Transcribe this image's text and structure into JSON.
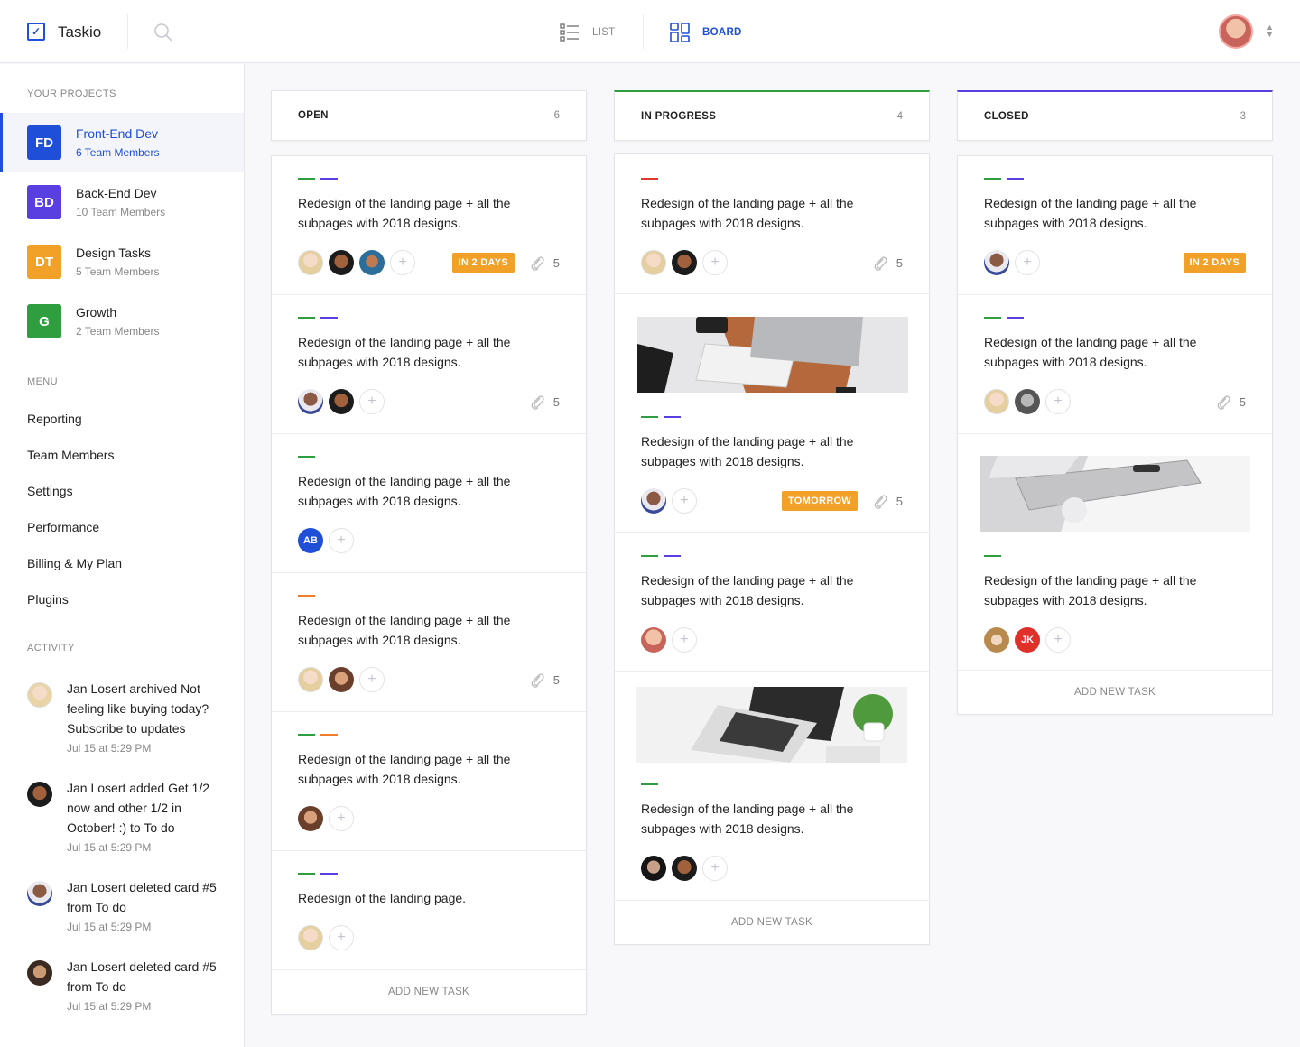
{
  "header": {
    "app_name": "Taskio",
    "view_list": "LIST",
    "view_board": "BOARD"
  },
  "sidebar": {
    "projects_title": "YOUR PROJECTS",
    "projects": [
      {
        "initials": "FD",
        "name": "Front-End Dev",
        "members": "6 Team Members",
        "color": "#1e4fd6"
      },
      {
        "initials": "BD",
        "name": "Back-End Dev",
        "members": "10 Team Members",
        "color": "#5a3fe0"
      },
      {
        "initials": "DT",
        "name": "Design Tasks",
        "members": "5 Team Members",
        "color": "#f2a128"
      },
      {
        "initials": "G",
        "name": "Growth",
        "members": "2 Team Members",
        "color": "#2e9e3e"
      }
    ],
    "menu_title": "MENU",
    "menu": [
      "Reporting",
      "Team Members",
      "Settings",
      "Performance",
      "Billing & My Plan",
      "Plugins"
    ],
    "activity_title": "ACTIVITY",
    "activity": [
      {
        "text": "Jan Losert archived Not feeling like buying today? Subscribe to updates",
        "time": "Jul 15 at 5:29 PM"
      },
      {
        "text": "Jan Losert added Get 1/2 now and other 1/2 in October! :) to To do",
        "time": "Jul 15 at 5:29 PM"
      },
      {
        "text": "Jan Losert deleted card #5 from To do",
        "time": "Jul 15 at 5:29 PM"
      },
      {
        "text": "Jan Losert deleted card #5 from To do",
        "time": "Jul 15 at 5:29 PM"
      }
    ]
  },
  "board": {
    "add_task": "ADD NEW TASK",
    "columns": [
      {
        "title": "OPEN",
        "count": "6",
        "cards": [
          {
            "title": "Redesign of the landing page + all the subpages with 2018 designs.",
            "due": "IN 2 DAYS",
            "attachments": "5"
          },
          {
            "title": "Redesign of the landing page + all the subpages with 2018 designs.",
            "attachments": "5"
          },
          {
            "title": "Redesign of the landing page + all the subpages with 2018 designs.",
            "avatar_initials": "AB"
          },
          {
            "title": "Redesign of the landing page + all the subpages with 2018 designs.",
            "attachments": "5"
          },
          {
            "title": "Redesign of the landing page + all the subpages with 2018 designs."
          },
          {
            "title": "Redesign of the landing page."
          }
        ]
      },
      {
        "title": "IN PROGRESS",
        "count": "4",
        "cards": [
          {
            "title": "Redesign of the landing page + all the subpages with 2018 designs.",
            "attachments": "5"
          },
          {
            "title": "Redesign of the landing page + all the subpages with 2018 designs.",
            "due": "TOMORROW",
            "attachments": "5"
          },
          {
            "title": "Redesign of the landing page + all the subpages with 2018 designs."
          },
          {
            "title": "Redesign of the landing page + all the subpages with 2018 designs."
          }
        ]
      },
      {
        "title": "CLOSED",
        "count": "3",
        "cards": [
          {
            "title": "Redesign of the landing page + all the subpages with 2018 designs.",
            "due": "IN 2 DAYS"
          },
          {
            "title": "Redesign of the landing page + all the subpages with 2018 designs.",
            "attachments": "5"
          },
          {
            "title": "Redesign of the landing page + all the subpages with 2018 designs.",
            "avatar_initials": "JK"
          }
        ]
      }
    ]
  },
  "colors": {
    "brand": "#1e4fd6",
    "green": "#2e9e3e",
    "purple": "#5a3fe0",
    "orange": "#ef7d2a",
    "red": "#e03a2a",
    "due": "#f2a128"
  }
}
